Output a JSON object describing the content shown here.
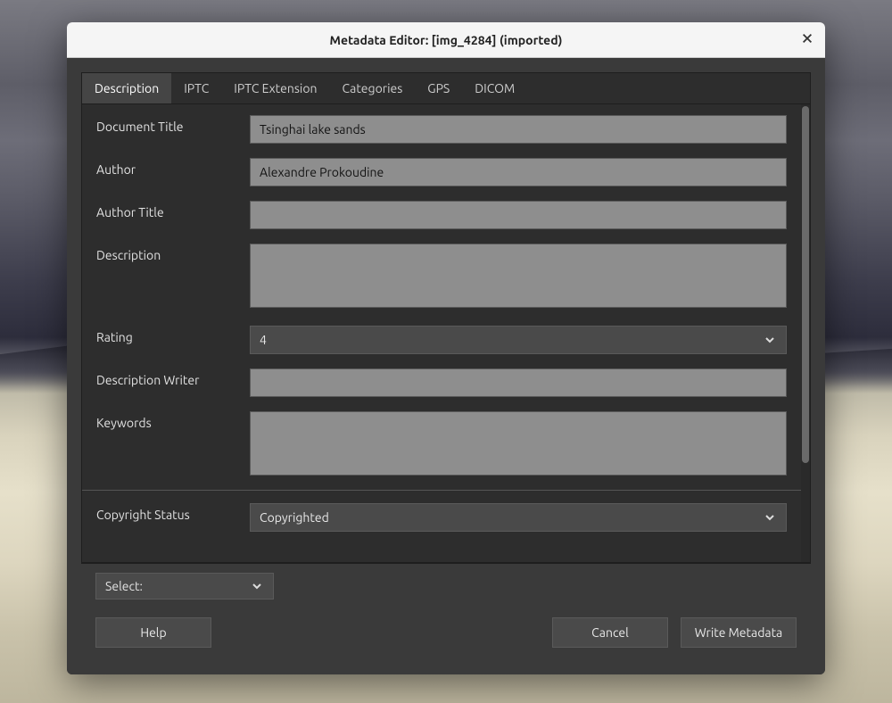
{
  "window": {
    "title": "Metadata Editor: [img_4284] (imported)"
  },
  "tabs": [
    {
      "label": "Description"
    },
    {
      "label": "IPTC"
    },
    {
      "label": "IPTC Extension"
    },
    {
      "label": "Categories"
    },
    {
      "label": "GPS"
    },
    {
      "label": "DICOM"
    }
  ],
  "active_tab": 0,
  "fields": {
    "document_title": {
      "label": "Document Title",
      "value": "Tsinghai lake sands"
    },
    "author": {
      "label": "Author",
      "value": "Alexandre Prokoudine"
    },
    "author_title": {
      "label": "Author Title",
      "value": ""
    },
    "description": {
      "label": "Description",
      "value": ""
    },
    "rating": {
      "label": "Rating",
      "value": "4"
    },
    "description_writer": {
      "label": "Description Writer",
      "value": ""
    },
    "keywords": {
      "label": "Keywords",
      "value": ""
    },
    "copyright_status": {
      "label": "Copyright Status",
      "value": "Copyrighted"
    }
  },
  "footer": {
    "select_label": "Select:"
  },
  "buttons": {
    "help": "Help",
    "cancel": "Cancel",
    "write": "Write Metadata"
  }
}
